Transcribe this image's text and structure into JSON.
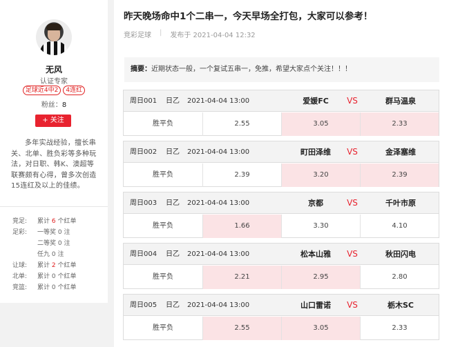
{
  "author": {
    "name": "无风",
    "role": "认证专家",
    "badges": [
      "足球近4中2",
      "4连红"
    ],
    "fans_label": "粉丝：",
    "fans_count": "8",
    "follow_label": "+ 关注",
    "bio": "多年实战经验，擅长串关、北单、胜负彩等多种玩法，对日职、韩K、澳超等联赛颇有心得，曾多次创造15连红及以上的佳绩。"
  },
  "stats": [
    {
      "key": "竞足:",
      "pre": "累计 ",
      "num": "6",
      "post": " 个红单",
      "red": true
    },
    {
      "key": "足彩:",
      "pre": "一等奖 ",
      "num": "0",
      "post": " 注",
      "red": false
    },
    {
      "key": "",
      "pre": "二等奖 ",
      "num": "0",
      "post": " 注",
      "red": false
    },
    {
      "key": "",
      "pre": "任九 ",
      "num": "0",
      "post": " 注",
      "red": false
    },
    {
      "key": "让球:",
      "pre": "累计 ",
      "num": "2",
      "post": " 个红单",
      "red": true
    },
    {
      "key": "北单:",
      "pre": "累计 ",
      "num": "0",
      "post": " 个红单",
      "red": false
    },
    {
      "key": "竞篮:",
      "pre": "累计 ",
      "num": "0",
      "post": " 个红单",
      "red": false
    }
  ],
  "article": {
    "title": "昨天晚场命中1个二串一，今天早场全打包，大家可以参考！",
    "category": "竞彩足球",
    "sep": "|",
    "published": "发布于 2021-04-04 12:32",
    "summary_label": "摘要：",
    "summary_text": "近期状态一般，一个复试五串一，免推，希望大家点个关注！！！"
  },
  "colors": {
    "accent": "#e8232f",
    "highlight": "#fbe3e5"
  },
  "matches": [
    {
      "num": "周日001",
      "league": "日乙",
      "time": "2021-04-04 13:00",
      "home": "爱媛FC",
      "vs": "VS",
      "away": "群马温泉",
      "market": "胜平负",
      "odds": [
        "2.55",
        "3.05",
        "2.33"
      ],
      "picked": [
        false,
        true,
        true
      ]
    },
    {
      "num": "周日002",
      "league": "日乙",
      "time": "2021-04-04 13:00",
      "home": "町田泽维",
      "vs": "VS",
      "away": "金泽塞维",
      "market": "胜平负",
      "odds": [
        "2.39",
        "3.20",
        "2.39"
      ],
      "picked": [
        false,
        true,
        true
      ]
    },
    {
      "num": "周日003",
      "league": "日乙",
      "time": "2021-04-04 13:00",
      "home": "京都",
      "vs": "VS",
      "away": "千叶市原",
      "market": "胜平负",
      "odds": [
        "1.66",
        "3.30",
        "4.10"
      ],
      "picked": [
        true,
        false,
        false
      ]
    },
    {
      "num": "周日004",
      "league": "日乙",
      "time": "2021-04-04 13:00",
      "home": "松本山雅",
      "vs": "VS",
      "away": "秋田闪电",
      "market": "胜平负",
      "odds": [
        "2.21",
        "2.95",
        "2.80"
      ],
      "picked": [
        true,
        true,
        false
      ]
    },
    {
      "num": "周日005",
      "league": "日乙",
      "time": "2021-04-04 13:00",
      "home": "山口雷诺",
      "vs": "VS",
      "away": "栃木SC",
      "market": "胜平负",
      "odds": [
        "2.55",
        "3.05",
        "2.33"
      ],
      "picked": [
        true,
        true,
        false
      ]
    }
  ]
}
